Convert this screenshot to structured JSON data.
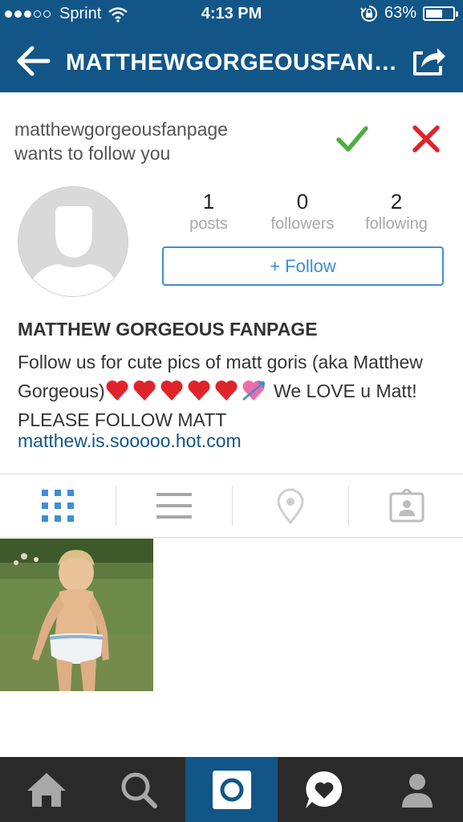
{
  "status_bar": {
    "carrier": "Sprint",
    "time": "4:13 PM",
    "battery_percent": "63%",
    "battery_level": 0.63,
    "signal_dots_filled": 3,
    "signal_dots_total": 5,
    "icons": [
      "wifi-icon",
      "rotation-lock-icon",
      "battery-icon"
    ]
  },
  "nav": {
    "title": "MATTHEWGORGEOUSFANP...",
    "back_icon": "arrow-left-icon",
    "share_icon": "share-icon"
  },
  "follow_request": {
    "text_line1": "matthewgorgeousfanpage",
    "text_line2": "wants to follow you",
    "accept_icon": "checkmark-icon",
    "decline_icon": "x-icon",
    "accept_color": "#4CAF3F",
    "decline_color": "#E0242B"
  },
  "profile": {
    "stats": [
      {
        "value": "1",
        "label": "posts"
      },
      {
        "value": "0",
        "label": "followers"
      },
      {
        "value": "2",
        "label": "following"
      }
    ],
    "follow_button": "+ Follow",
    "full_name": "MATTHEW GORGEOUS FANPAGE",
    "bio_part1": "Follow us for cute pics of matt goris (aka Matthew Gorgeous)",
    "bio_emojis": [
      "red-heart",
      "red-heart",
      "red-heart",
      "red-heart",
      "red-heart",
      "heart-with-arrow"
    ],
    "bio_part2": " We LOVE u Matt! PLEASE FOLLOW MATT",
    "website": "matthew.is.sooooo.hot.com"
  },
  "tabs": [
    {
      "name": "grid-view",
      "icon": "grid-icon",
      "active": true
    },
    {
      "name": "list-view",
      "icon": "list-icon",
      "active": false
    },
    {
      "name": "photo-map",
      "icon": "location-pin-icon",
      "active": false
    },
    {
      "name": "tagged-photos",
      "icon": "person-tag-icon",
      "active": false
    }
  ],
  "photos": [
    {
      "description_icon": "photo-thumbnail"
    }
  ],
  "bottom_nav": [
    {
      "name": "home",
      "icon": "home-icon",
      "active": false
    },
    {
      "name": "explore",
      "icon": "search-icon",
      "active": false
    },
    {
      "name": "camera",
      "icon": "camera-icon",
      "active": true
    },
    {
      "name": "activity",
      "icon": "activity-heart-bubble-icon",
      "active": false
    },
    {
      "name": "profile",
      "icon": "profile-icon",
      "active": false
    }
  ],
  "colors": {
    "brand_blue": "#125688",
    "link_blue": "#3F8ED1",
    "bottom_bar": "#2A2A2A"
  }
}
